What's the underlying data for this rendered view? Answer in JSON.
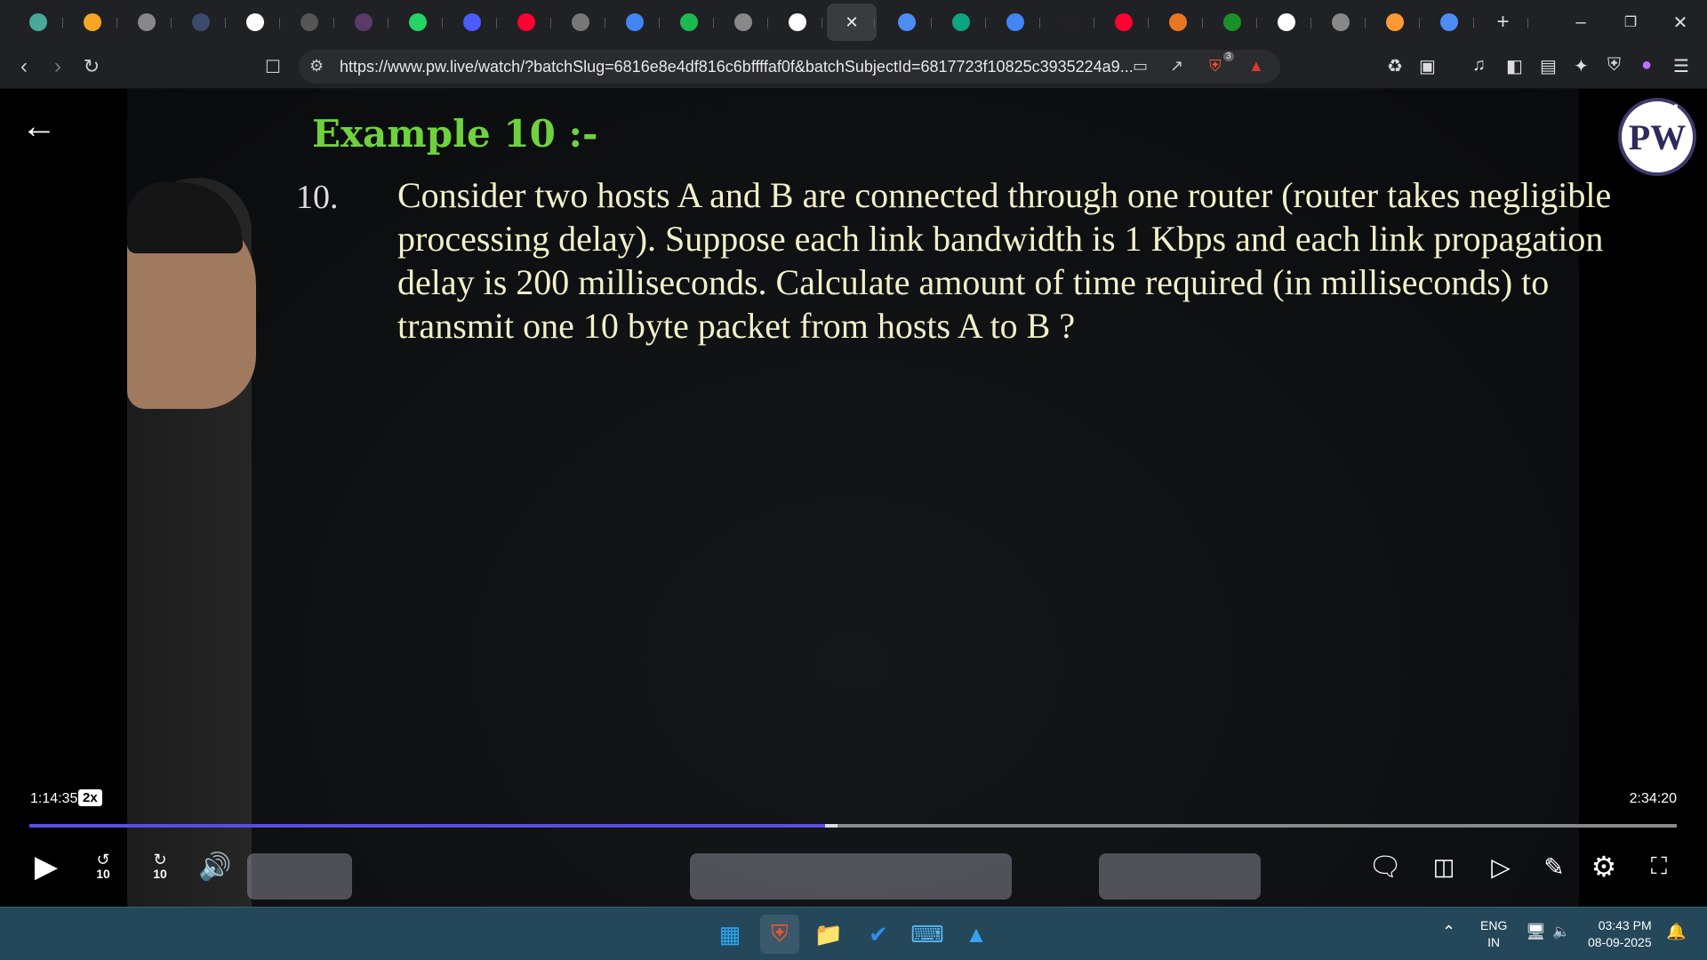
{
  "browser": {
    "tabs": [
      {
        "icon": "monitor-icon",
        "color": "#4aa89a"
      },
      {
        "icon": "circle-logo-icon",
        "color": "#f5a623"
      },
      {
        "icon": "globe-icon",
        "color": "#888"
      },
      {
        "icon": "sql-icon",
        "color": "#3a4a6a"
      },
      {
        "icon": "wordpress-icon",
        "color": "#fff"
      },
      {
        "icon": "dark-site-icon",
        "color": "#555"
      },
      {
        "icon": "purple-site-icon",
        "color": "#5a3a6a"
      },
      {
        "icon": "whatsapp-icon",
        "color": "#25d366"
      },
      {
        "icon": "bookmark-app-icon",
        "color": "#4b5cff"
      },
      {
        "icon": "youtube-icon",
        "color": "#ff0033"
      },
      {
        "icon": "code-site-icon",
        "color": "#777"
      },
      {
        "icon": "google-icon",
        "color": "#4285f4"
      },
      {
        "icon": "spotify-icon",
        "color": "#1db954"
      },
      {
        "icon": "globe-icon",
        "color": "#888"
      },
      {
        "icon": "wikipedia-icon",
        "color": "#fff"
      },
      {
        "icon": "close-icon",
        "color": "#3a3b3e",
        "active": true
      },
      {
        "icon": "gemini-icon",
        "color": "#4f8bf5"
      },
      {
        "icon": "chatgpt-icon",
        "color": "#10a37f"
      },
      {
        "icon": "google-icon",
        "color": "#4285f4"
      },
      {
        "icon": "tablet-icon",
        "color": "#222"
      },
      {
        "icon": "youtube-icon",
        "color": "#ff0033"
      },
      {
        "icon": "orange-site-icon",
        "color": "#e87722"
      },
      {
        "icon": "green-site-icon",
        "color": "#1a8f2a"
      },
      {
        "icon": "wikipedia-icon",
        "color": "#fff"
      },
      {
        "icon": "globe-icon",
        "color": "#888"
      },
      {
        "icon": "india-flag-icon",
        "color": "#ff9933"
      },
      {
        "icon": "gemini-icon",
        "color": "#4f8bf5"
      }
    ],
    "new_tab": "+",
    "url": "https://www.pw.live/watch/?batchSlug=6816e8e4df816c6bffffaf0f&batchSubjectId=6817723f10825c3935224a9...",
    "brave_badge": "3"
  },
  "slide": {
    "title": "Example 10 :-",
    "question_number": "10.",
    "question": "Consider two hosts A and B are connected through one router (router takes negligible processing delay). Suppose each link bandwidth is 1 Kbps and each link propagation delay is 200 milliseconds. Calculate amount of time required (in milliseconds) to transmit one 10 byte packet from hosts A to B ?",
    "logo": "PW"
  },
  "player": {
    "current_time": "1:14:35",
    "speed": "2x",
    "duration": "2:34:20",
    "progress_percent": 48.3,
    "skip_back": "10",
    "skip_forward": "10",
    "accent": "#5b4de0"
  },
  "taskbar": {
    "lang": "ENG",
    "region": "IN",
    "time": "03:43 PM",
    "date": "08-09-2025"
  }
}
